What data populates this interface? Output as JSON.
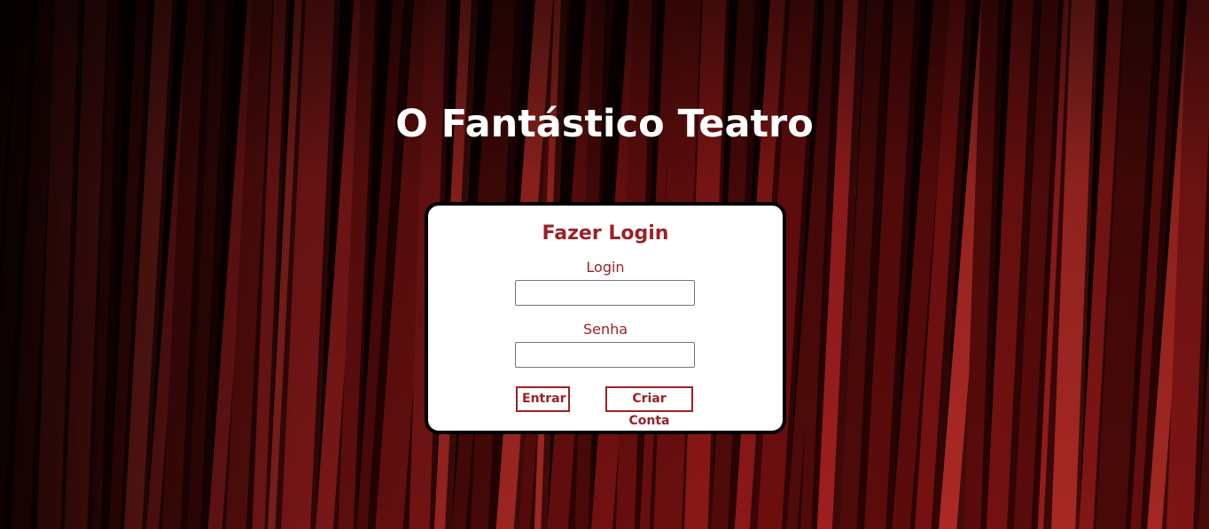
{
  "page": {
    "title": "O Fantástico Teatro",
    "background": "red-theater-curtain"
  },
  "login_form": {
    "heading": "Fazer Login",
    "login_label": "Login",
    "login_value": "",
    "password_label": "Senha",
    "password_value": "",
    "enter_button": "Entrar",
    "create_account_button": "Criar Conta"
  },
  "colors": {
    "accent": "#9b2226",
    "card_background": "#ffffff",
    "card_border": "#000000",
    "title_text": "#ffffff"
  }
}
